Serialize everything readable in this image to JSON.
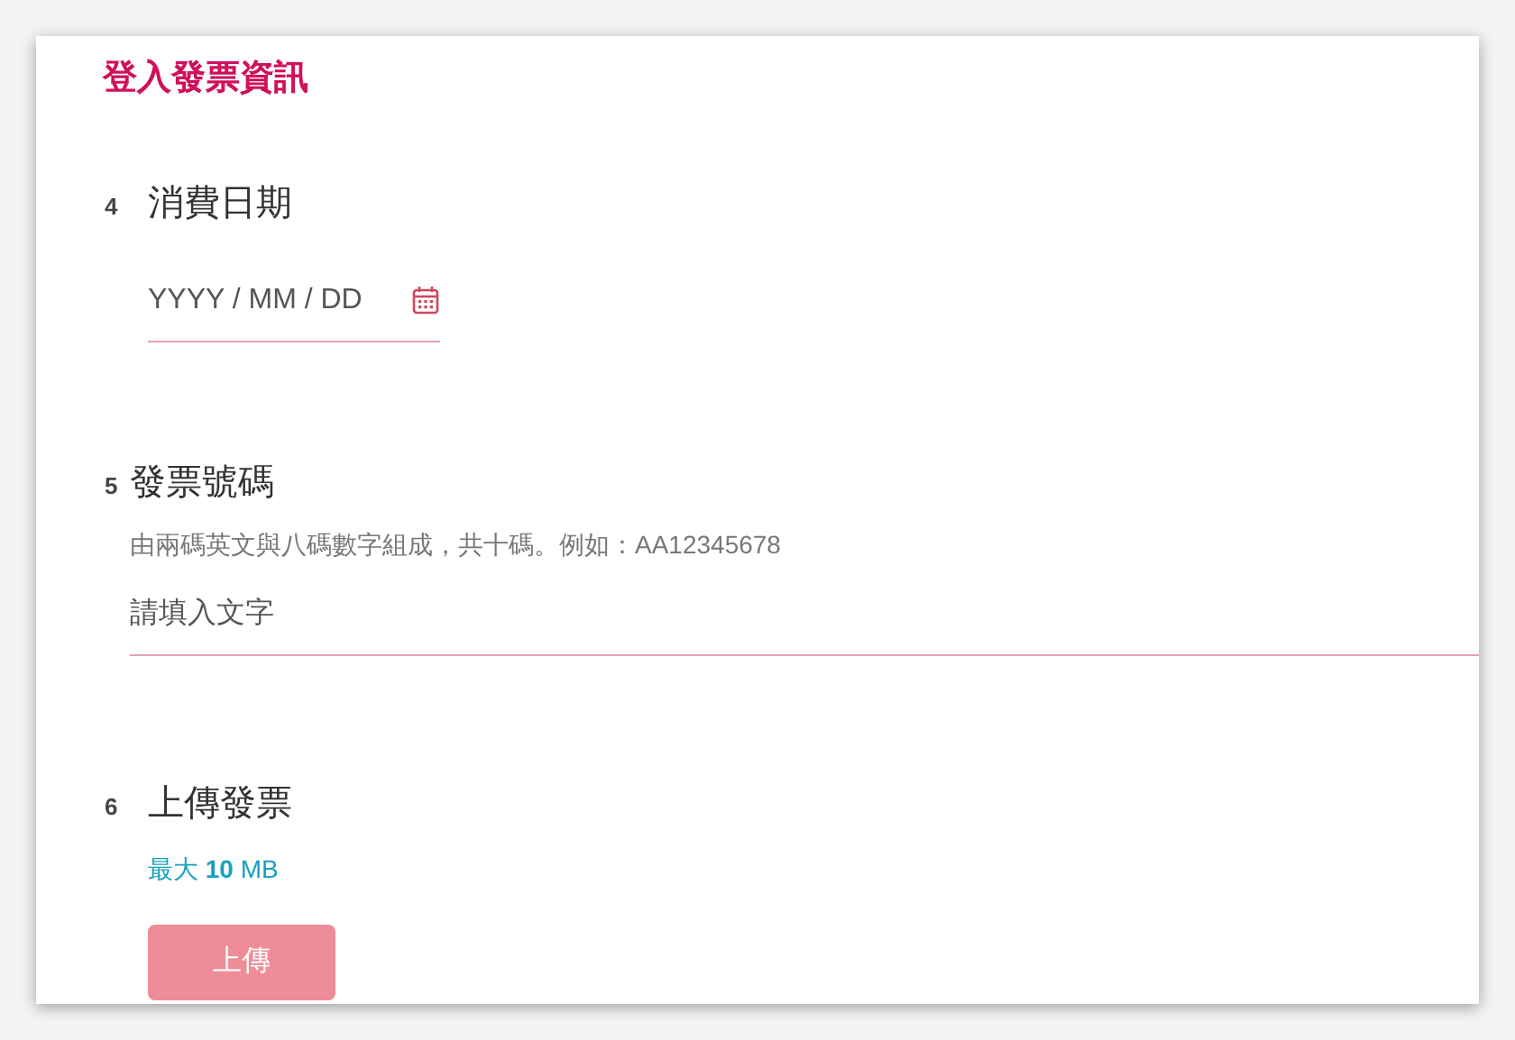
{
  "title": "登入發票資訊",
  "sections": [
    {
      "kind": "date",
      "number": "4",
      "label": "消費日期",
      "placeholder": "YYYY / MM / DD"
    },
    {
      "kind": "text",
      "number": "5",
      "label": "發票號碼",
      "hint": "由兩碼英文與八碼數字組成，共十碼。例如：AA12345678",
      "placeholder": "請填入文字"
    },
    {
      "kind": "upload",
      "number": "6",
      "label": "上傳發票",
      "note": "最大 **10** MB",
      "button": {
        "label": "上傳",
        "disabled": true
      }
    }
  ]
}
